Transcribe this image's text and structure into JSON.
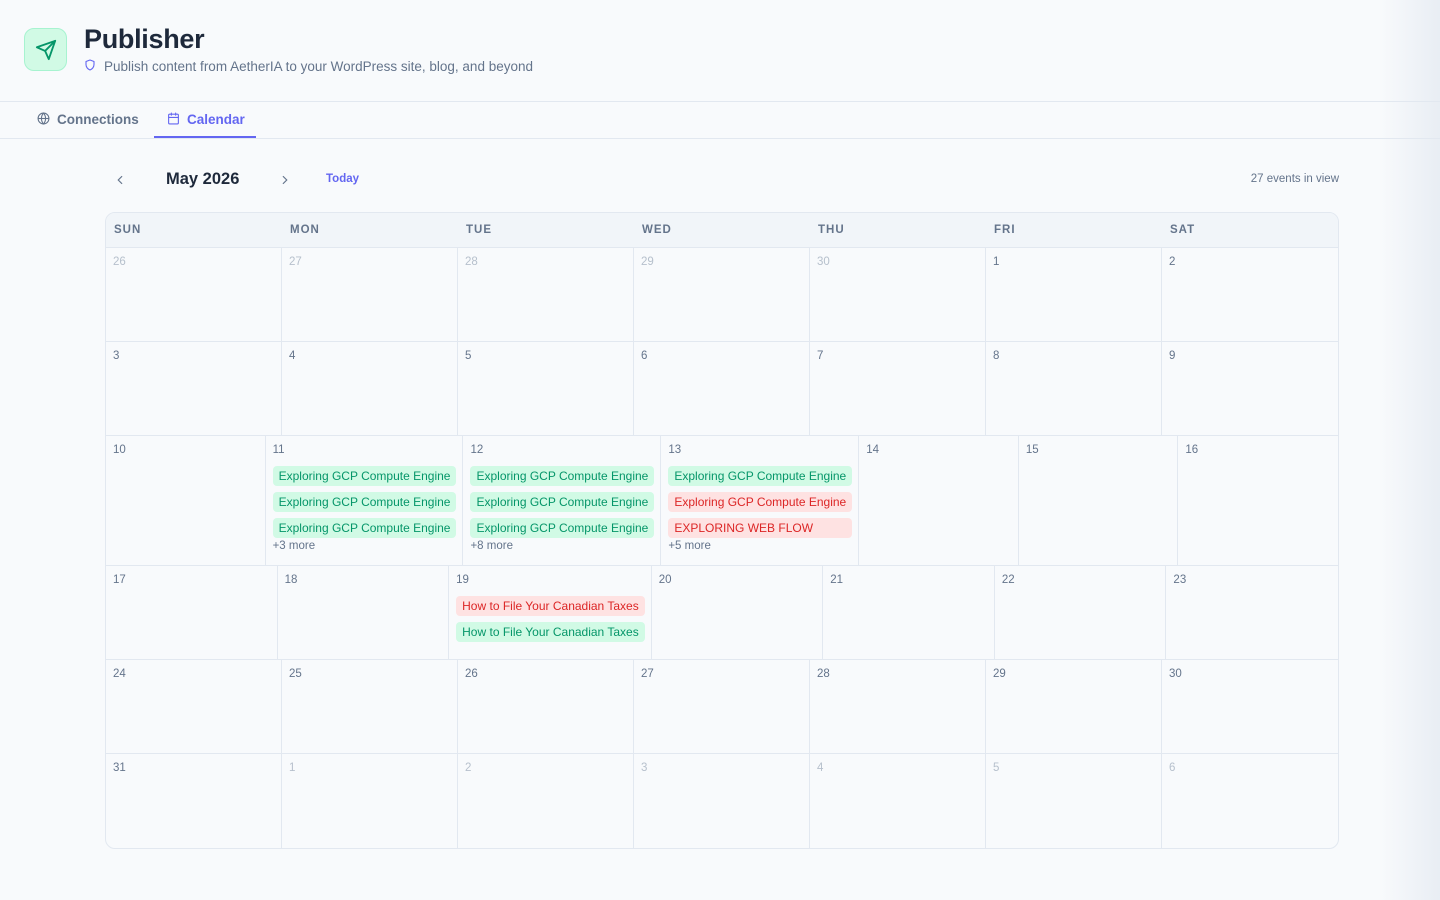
{
  "header": {
    "title": "Publisher",
    "subtitle": "Publish content from AetherIA to your WordPress site, blog, and beyond"
  },
  "tabs": [
    {
      "label": "Connections",
      "icon": "globe-icon",
      "active": false
    },
    {
      "label": "Calendar",
      "icon": "calendar-icon",
      "active": true
    }
  ],
  "toolbar": {
    "month_label": "May 2026",
    "today_label": "Today",
    "event_count": "27 events in view"
  },
  "weekdays": [
    "SUN",
    "MON",
    "TUE",
    "WED",
    "THU",
    "FRI",
    "SAT"
  ],
  "weeks": [
    {
      "size": "normal",
      "days": [
        {
          "num": "26",
          "outside": true
        },
        {
          "num": "27",
          "outside": true
        },
        {
          "num": "28",
          "outside": true
        },
        {
          "num": "29",
          "outside": true
        },
        {
          "num": "30",
          "outside": true
        },
        {
          "num": "1"
        },
        {
          "num": "2"
        }
      ]
    },
    {
      "size": "normal",
      "days": [
        {
          "num": "3"
        },
        {
          "num": "4"
        },
        {
          "num": "5"
        },
        {
          "num": "6"
        },
        {
          "num": "7"
        },
        {
          "num": "8"
        },
        {
          "num": "9"
        }
      ]
    },
    {
      "size": "tall",
      "days": [
        {
          "num": "10"
        },
        {
          "num": "11",
          "events": [
            {
              "title": "Exploring GCP Compute Engine",
              "status": "green"
            },
            {
              "title": "Exploring GCP Compute Engine",
              "status": "green"
            },
            {
              "title": "Exploring GCP Compute Engine",
              "status": "green"
            }
          ],
          "more": "+3 more"
        },
        {
          "num": "12",
          "events": [
            {
              "title": "Exploring GCP Compute Engine",
              "status": "green"
            },
            {
              "title": "Exploring GCP Compute Engine",
              "status": "green"
            },
            {
              "title": "Exploring GCP Compute Engine",
              "status": "green"
            }
          ],
          "more": "+8 more"
        },
        {
          "num": "13",
          "events": [
            {
              "title": "Exploring GCP Compute Engine",
              "status": "green"
            },
            {
              "title": "Exploring GCP Compute Engine",
              "status": "red"
            },
            {
              "title": "EXPLORING WEB FLOW",
              "status": "red"
            }
          ],
          "more": "+5 more"
        },
        {
          "num": "14"
        },
        {
          "num": "15"
        },
        {
          "num": "16"
        }
      ]
    },
    {
      "size": "normal",
      "days": [
        {
          "num": "17"
        },
        {
          "num": "18"
        },
        {
          "num": "19",
          "events": [
            {
              "title": "How to File Your Canadian Taxes",
              "status": "red"
            },
            {
              "title": "How to File Your Canadian Taxes",
              "status": "green"
            }
          ]
        },
        {
          "num": "20"
        },
        {
          "num": "21"
        },
        {
          "num": "22"
        },
        {
          "num": "23"
        }
      ]
    },
    {
      "size": "normal",
      "days": [
        {
          "num": "24"
        },
        {
          "num": "25"
        },
        {
          "num": "26"
        },
        {
          "num": "27"
        },
        {
          "num": "28"
        },
        {
          "num": "29"
        },
        {
          "num": "30"
        }
      ]
    },
    {
      "size": "normal",
      "days": [
        {
          "num": "31"
        },
        {
          "num": "1",
          "outside": true
        },
        {
          "num": "2",
          "outside": true
        },
        {
          "num": "3",
          "outside": true
        },
        {
          "num": "4",
          "outside": true
        },
        {
          "num": "5",
          "outside": true
        },
        {
          "num": "6",
          "outside": true
        }
      ]
    }
  ],
  "colors": {
    "accent": "#6366f1",
    "published": "#059669",
    "failed": "#dc2626"
  }
}
